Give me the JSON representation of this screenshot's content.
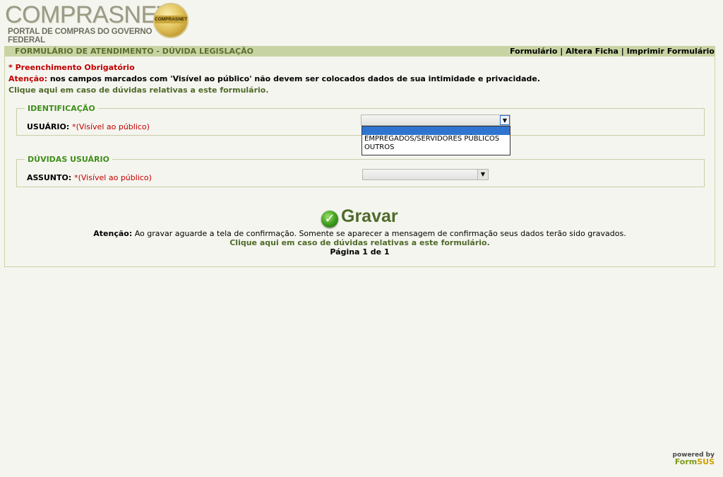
{
  "header": {
    "brand": "COMPRASNET",
    "tagline": "PORTAL DE COMPRAS DO GOVERNO FEDERAL",
    "seal_text": "COMPRASNET"
  },
  "titlebar": {
    "title": "FORMULÁRIO DE ATENDIMENTO - DÚVIDA LEGISLAÇÃO",
    "link_formulario": "Formulário",
    "link_altera_ficha": "Altera Ficha",
    "link_imprimir": "Imprimir Formulário",
    "separator": "|"
  },
  "notices": {
    "required": "* Preenchimento Obrigatório",
    "attention_prefix": "Atenção:",
    "attention_text": "nos campos marcados com 'Visível ao público' não devem ser colocados dados de sua intimidade e privacidade.",
    "help_link": "Clique aqui em caso de dúvidas relativas a este formulário."
  },
  "sections": {
    "identificacao": {
      "legend": "IDENTIFICAÇÃO",
      "field_label": "USUÁRIO:",
      "visibility": "*(Visível ao público)",
      "selected_value": "",
      "options": [
        "",
        "EMPREGADOS/SERVIDORES PÚBLICOS",
        "OUTROS"
      ]
    },
    "duvidas": {
      "legend": "DÚVIDAS USUÁRIO",
      "field_label": "ASSUNTO:",
      "visibility": "*(Visível ao público)",
      "selected_value": ""
    }
  },
  "footer": {
    "save_label": "Gravar",
    "attention_prefix": "Atenção:",
    "attention_text": "Ao gravar aguarde a tela de confirmação. Somente se aparecer a mensagem de confirmação seus dados terão sido gravados.",
    "help_link": "Clique aqui em caso de dúvidas relativas a este formulário.",
    "page_indicator": "Página 1 de 1"
  },
  "powered_by": {
    "line1": "powered by",
    "brand_form": "Form",
    "brand_sus": "SUS"
  },
  "colors": {
    "titlebar": "#c8d4a4",
    "legend_green": "#3f8e1a",
    "link_green": "#4f6a2a",
    "required_red": "#c00000",
    "dropdown_highlight": "#2f74d0"
  }
}
